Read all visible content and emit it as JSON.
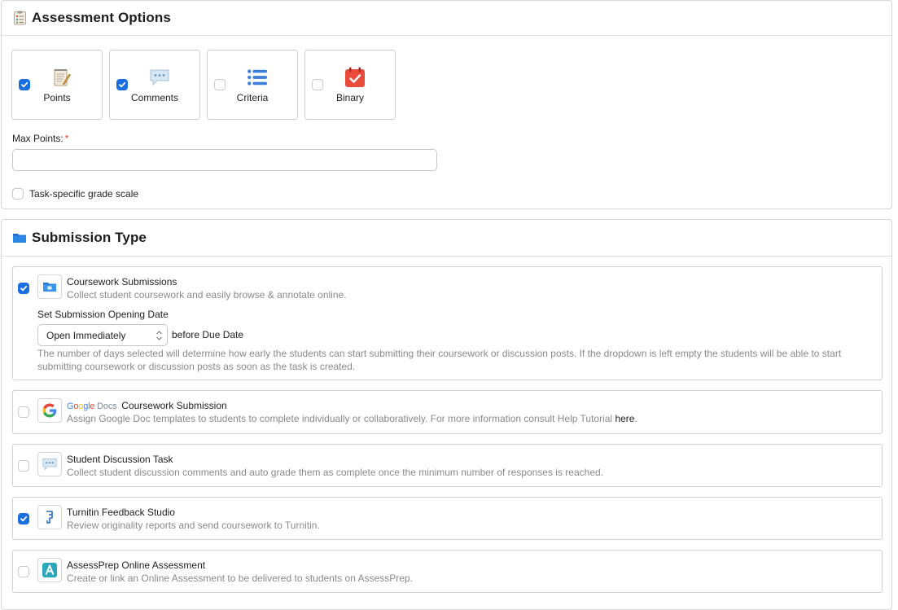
{
  "assessment": {
    "title": "Assessment Options",
    "header_icon": "clipboard-list-icon",
    "options": [
      {
        "label": "Points",
        "checked": true,
        "icon": "notepad-pencil-icon"
      },
      {
        "label": "Comments",
        "checked": true,
        "icon": "speech-bubble-icon"
      },
      {
        "label": "Criteria",
        "checked": false,
        "icon": "bullet-list-icon"
      },
      {
        "label": "Binary",
        "checked": false,
        "icon": "calendar-check-icon"
      }
    ],
    "max_points": {
      "label": "Max Points:",
      "required_mark": "*",
      "value": "",
      "placeholder": ""
    },
    "grade_scale": {
      "label": "Task-specific grade scale",
      "checked": false
    }
  },
  "submission": {
    "title": "Submission Type",
    "header_icon": "folder-icon",
    "coursework": {
      "checked": true,
      "icon": "folder-blue-icon",
      "title": "Coursework Submissions",
      "description": "Collect student coursework and easily browse & annotate online.",
      "opening_label": "Set Submission Opening Date",
      "select_value": "Open Immediately",
      "after_select": "before Due Date",
      "help": "The number of days selected will determine how early the students can start submitting their coursework or discussion posts. If the dropdown is left empty the students will be able to start submitting coursework or discussion posts as soon as the task is created."
    },
    "google": {
      "checked": false,
      "icon": "google-g-icon",
      "logo_google": "Google",
      "logo_docs": "Docs",
      "title": "Coursework Submission",
      "description": "Assign Google Doc templates to students to complete individually or collaboratively. For more information consult Help Tutorial",
      "link": "here",
      "link_suffix": "."
    },
    "discussion": {
      "checked": false,
      "icon": "speech-bubble-icon",
      "title": "Student Discussion Task",
      "description": "Collect student discussion comments and auto grade them as complete once the minimum number of responses is reached."
    },
    "turnitin": {
      "checked": true,
      "icon": "turnitin-icon",
      "title": "Turnitin Feedback Studio",
      "description": "Review originality reports and send coursework to Turnitin."
    },
    "assessprep": {
      "checked": false,
      "icon": "assessprep-a-icon",
      "title": "AssessPrep Online Assessment",
      "description": "Create or link an Online Assessment to be delivered to students on AssessPrep."
    }
  },
  "colors": {
    "accent": "#1a6fe0",
    "required": "#e23b3b",
    "muted_text": "#8a8a8a"
  }
}
